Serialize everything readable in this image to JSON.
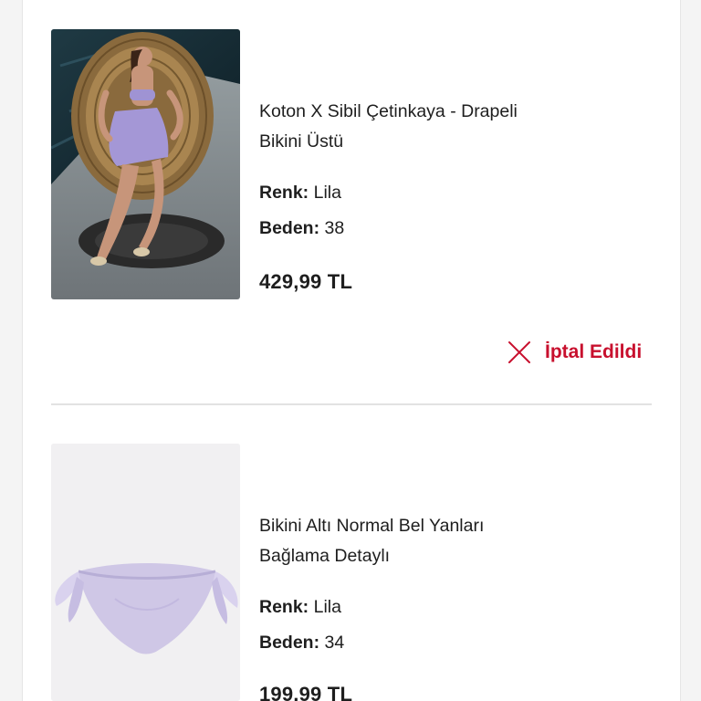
{
  "colors": {
    "accent": "#c8102e",
    "divider": "#e2e2e2",
    "text": "#1e1e1e"
  },
  "order_items": [
    {
      "image_icon": "woman-in-bikini-on-wicker-chair-photo",
      "title_line1": "Koton X Sibil Çetinkaya - Drapeli",
      "title_line2": "Bikini Üstü",
      "color_label": "Renk:",
      "color_value": "Lila",
      "size_label": "Beden:",
      "size_value": "38",
      "price": "429,99 TL",
      "status_icon": "close-icon",
      "status": "İptal Edildi"
    },
    {
      "image_icon": "lilac-bikini-bottom-photo",
      "title_line1": "Bikini Altı Normal Bel Yanları",
      "title_line2": "Bağlama Detaylı",
      "color_label": "Renk:",
      "color_value": "Lila",
      "size_label": "Beden:",
      "size_value": "34",
      "price": "199,99 TL"
    }
  ]
}
